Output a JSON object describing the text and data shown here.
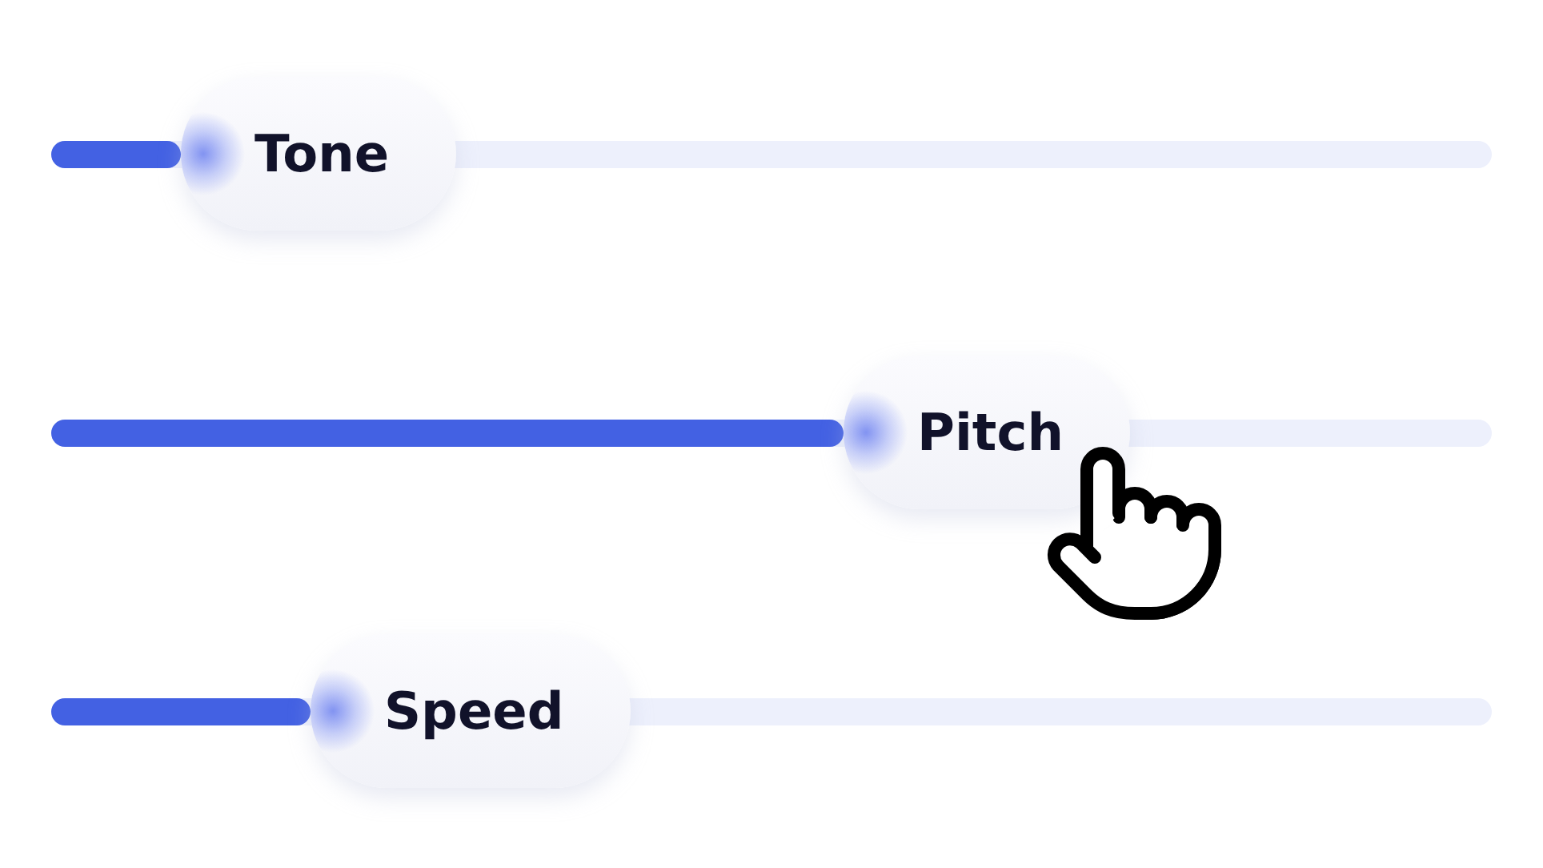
{
  "sliders": [
    {
      "label": "Tone",
      "level": 0.09,
      "grabbed": false
    },
    {
      "label": "Pitch",
      "level": 0.55,
      "grabbed": true
    },
    {
      "label": "Speed",
      "level": 0.18,
      "grabbed": false
    }
  ]
}
